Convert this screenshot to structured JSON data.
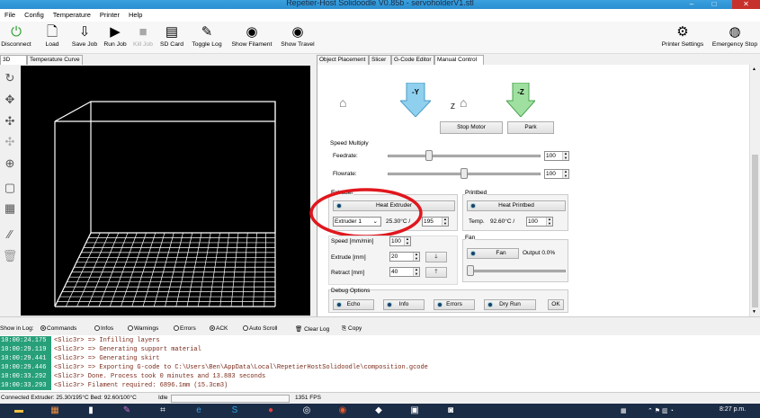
{
  "window": {
    "title": "Repetier-Host Solidoodle V0.85b - servoholderV1.stl",
    "min": "–",
    "max": "□",
    "close": "✕"
  },
  "menu": [
    "File",
    "Config",
    "Temperature",
    "Printer",
    "Help"
  ],
  "toolbar": {
    "disconnect": "Disconnect",
    "load": "Load",
    "save_job": "Save Job",
    "run_job": "Run Job",
    "kill_job": "Kill Job",
    "sd_card": "SD Card",
    "toggle_log": "Toggle Log",
    "show_filament": "Show Filament",
    "show_travel": "Show Travel",
    "printer_settings": "Printer Settings",
    "emergency_stop": "Emergency Stop"
  },
  "left_tabs": [
    "3D View",
    "Temperature Curve"
  ],
  "right_tabs": [
    "Object Placement",
    "Slicer",
    "G-Code Editor",
    "Manual Control"
  ],
  "manual": {
    "y_label": "-Y",
    "z_label": "Z",
    "minus_z_label": "-Z",
    "stop_motor": "Stop Motor",
    "park": "Park",
    "speed_multiply": "Speed Multiply",
    "feedrate_label": "Feedrate:",
    "feedrate_value": "100",
    "feedrate_level": 0.27,
    "flowrate_label": "Flowrate:",
    "flowrate_value": "100",
    "flowrate_level": 0.5,
    "extruder": {
      "title": "Extruder",
      "heat_button": "Heat Extruder",
      "select": "Extruder 1",
      "temp": "25.30°C /",
      "target": "195"
    },
    "printbed": {
      "title": "Printbed",
      "heat_button": "Heat Printbed",
      "temp_label": "Temp.",
      "temp": "92.60°C /",
      "target": "100"
    },
    "speed": {
      "label": "Speed [mm/min]",
      "value": "100"
    },
    "extrude": {
      "label": "Extrude [mm]",
      "value": "20"
    },
    "retract": {
      "label": "Retract [mm]",
      "value": "40"
    },
    "fan": {
      "title": "Fan",
      "button": "Fan",
      "output": "Output 0.0%"
    },
    "debug": {
      "title": "Debug Options",
      "echo": "Echo",
      "info": "Info",
      "errors": "Errors",
      "dry_run": "Dry Run",
      "ok": "OK"
    }
  },
  "log_options": {
    "show_in_log": "Show in Log:",
    "commands": "Commands",
    "infos": "Infos",
    "warnings": "Warnings",
    "errors": "Errors",
    "ack": "ACK",
    "auto_scroll": "Auto Scroll",
    "clear_log": "Clear Log",
    "copy": "Copy"
  },
  "log": [
    {
      "ts": "10:00:24.175",
      "text": "<Slic3r> => Infilling layers"
    },
    {
      "ts": "10:00:29.119",
      "text": "<Slic3r> => Generating support material"
    },
    {
      "ts": "10:00:29.441",
      "text": "<Slic3r> => Generating skirt"
    },
    {
      "ts": "10:00:29.446",
      "text": "<Slic3r> => Exporting G-code to C:\\Users\\Ben\\AppData\\Local\\RepetierHostSolidoodle\\composition.gcode"
    },
    {
      "ts": "10:00:33.292",
      "text": "<Slic3r> Done. Process took 0 minutes and 13.883 seconds"
    },
    {
      "ts": "10:00:33.293",
      "text": "<Slic3r> Filament required: 6896.1mm (15.3cm3)"
    }
  ],
  "status": {
    "connected": "Connected  Extruder: 25.30/195°C Bed: 92.60/100°C",
    "idle": "Idle",
    "fps": "1351 FPS"
  },
  "taskbar": {
    "clock": "8:27 p.m."
  },
  "colors": {
    "accent_red": "#e0171d",
    "log_timestamp_bg": "#27a07a",
    "arrow_blue": "#8fd0ee",
    "arrow_green": "#9fe0a0"
  }
}
